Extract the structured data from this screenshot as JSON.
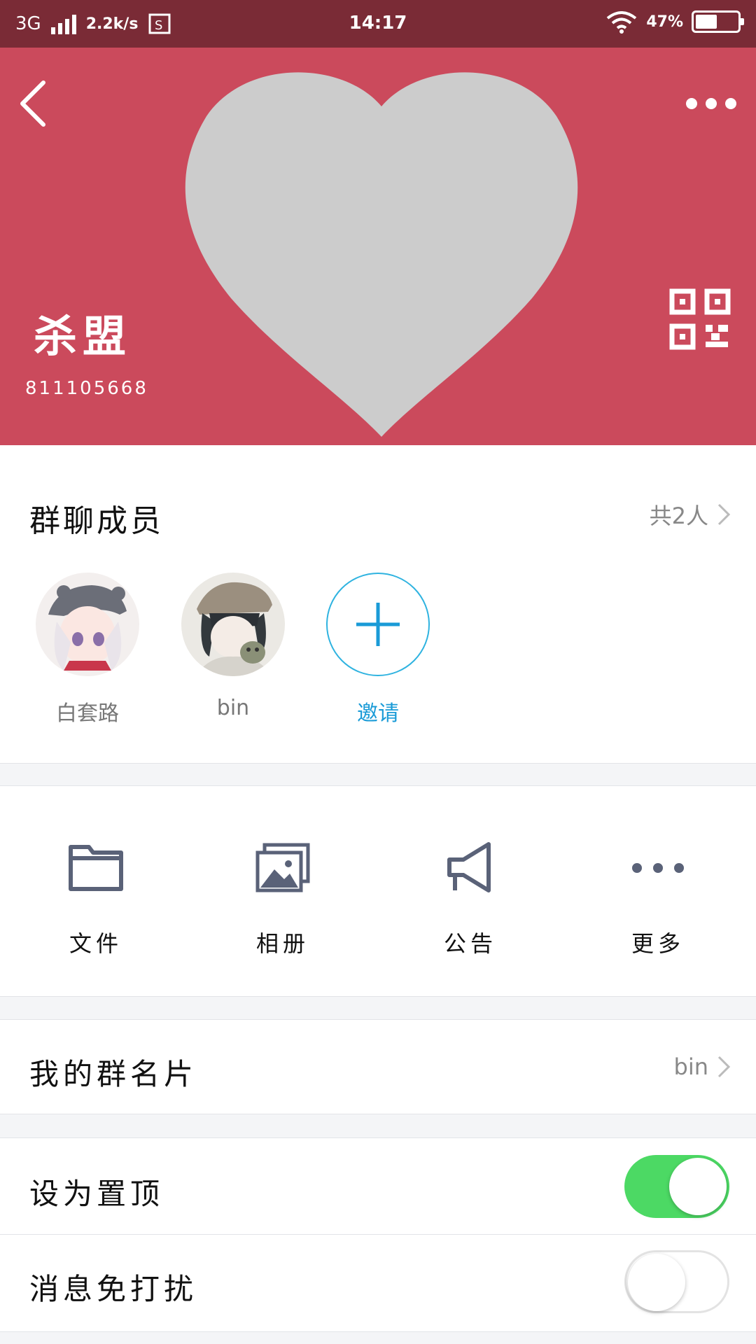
{
  "status_bar": {
    "network": "3G",
    "speed": "2.2k/s",
    "time": "14:17",
    "battery": "47%"
  },
  "header": {
    "group_name": "杀盟",
    "group_id": "811105668",
    "background_color": "#cb4a5c"
  },
  "members": {
    "title": "群聊成员",
    "count": "共2人",
    "list": [
      {
        "name": "白套路"
      },
      {
        "name": "bin"
      }
    ],
    "invite_label": "邀请"
  },
  "actions": [
    {
      "label": "文件",
      "icon": "folder-icon"
    },
    {
      "label": "相册",
      "icon": "album-icon"
    },
    {
      "label": "公告",
      "icon": "megaphone-icon"
    },
    {
      "label": "更多",
      "icon": "more-dots-icon"
    }
  ],
  "my_card": {
    "label": "我的群名片",
    "value": "bin"
  },
  "pin_top": {
    "label": "设为置顶",
    "enabled": true
  },
  "mute": {
    "label": "消息免打扰",
    "enabled": false
  },
  "colors": {
    "accent_blue": "#1a9bd7",
    "toggle_green": "#4cd964",
    "icon_gray": "#5a6278"
  }
}
